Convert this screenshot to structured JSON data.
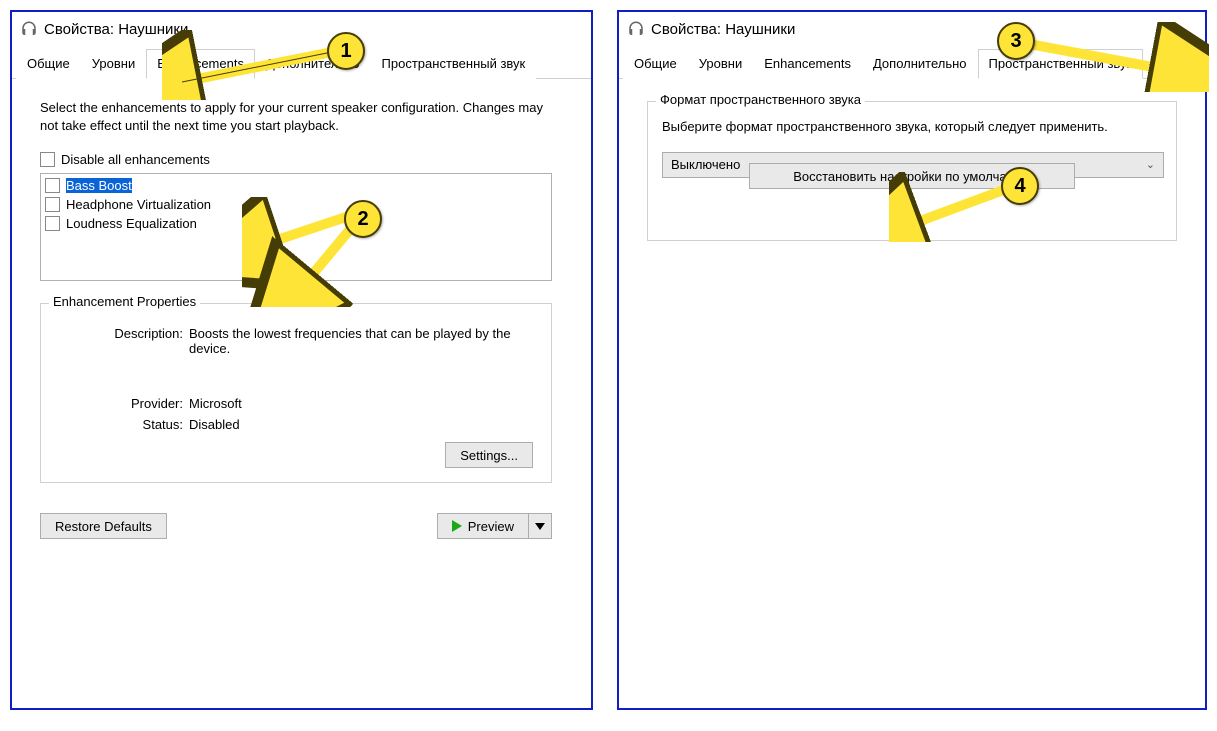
{
  "annotations": {
    "a1": "1",
    "a2": "2",
    "a3": "3",
    "a4": "4"
  },
  "left": {
    "title": "Свойства: Наушники",
    "tabs": [
      "Общие",
      "Уровни",
      "Enhancements",
      "Дополнительно",
      "Пространственный звук"
    ],
    "activeTab": 2,
    "instructions": "Select the enhancements to apply for your current speaker configuration. Changes may not take effect until the next time you start playback.",
    "disableAll": "Disable all enhancements",
    "items": [
      "Bass Boost",
      "Headphone Virtualization",
      "Loudness Equalization"
    ],
    "selectedItem": 0,
    "propsLegend": "Enhancement Properties",
    "descLabel": "Description:",
    "descVal": "Boosts the lowest frequencies that can be played by the device.",
    "provLabel": "Provider:",
    "provVal": "Microsoft",
    "statLabel": "Status:",
    "statVal": "Disabled",
    "settingsBtn": "Settings...",
    "restoreBtn": "Restore Defaults",
    "previewBtn": "Preview"
  },
  "right": {
    "title": "Свойства: Наушники",
    "tabs": [
      "Общие",
      "Уровни",
      "Enhancements",
      "Дополнительно",
      "Пространственный звук"
    ],
    "activeTab": 4,
    "groupLegend": "Формат пространственного звука",
    "desc": "Выберите формат пространственного звука, который следует применить.",
    "comboValue": "Выключено",
    "restoreBtn": "Восстановить настройки по умолчанию"
  }
}
